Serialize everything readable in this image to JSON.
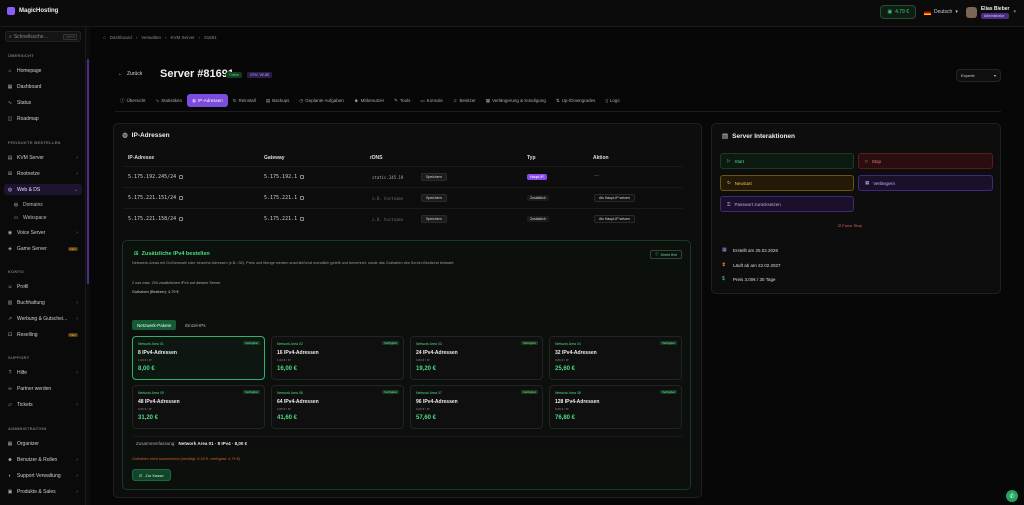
{
  "brand": {
    "name": "MagicHosting",
    "accent": "#8b5cf6",
    "success": "#4ade80"
  },
  "topbar": {
    "balance": "4,79 €",
    "language": "Deutsch",
    "user_name": "Elias Bieber",
    "user_role": "Administrator"
  },
  "sidebar": {
    "search_placeholder": "Schnellsuche...",
    "search_shortcut": "Ctrl+K",
    "sections": {
      "overview": "ÜBERSICHT",
      "products": "PRODUKTE BESTELLEN",
      "konto": "KONTO",
      "support": "SUPPORT",
      "admin": "ADMINISTRATION"
    },
    "items": [
      {
        "label": "Homepage"
      },
      {
        "label": "Dashboard"
      },
      {
        "label": "Status"
      },
      {
        "label": "Roadmap"
      },
      {
        "label": "KVM Server"
      },
      {
        "label": "Rootnetze"
      },
      {
        "label": "Web & DS"
      },
      {
        "label": "Domains"
      },
      {
        "label": "Webspace"
      },
      {
        "label": "Voice Server"
      },
      {
        "label": "Game Server",
        "badge": "NEU"
      },
      {
        "label": "Profil"
      },
      {
        "label": "Buchhaltung"
      },
      {
        "label": "Werbung & Gutschei..."
      },
      {
        "label": "Reselling",
        "badge": "NEU"
      },
      {
        "label": "Hilfe"
      },
      {
        "label": "Partner werden"
      },
      {
        "label": "Tickets"
      },
      {
        "label": "Organizer"
      },
      {
        "label": "Benutzer & Rollen"
      },
      {
        "label": "Support Verwaltung"
      },
      {
        "label": "Produkte & Sales"
      }
    ]
  },
  "breadcrumb": [
    "Dashboard",
    "Verwalten",
    "KVM Server",
    "81691"
  ],
  "header": {
    "back": "Zurück",
    "title": "Server #81691",
    "status": "Online",
    "cpu": "CPU: VE-85",
    "export": "Experte"
  },
  "tabs": [
    "Übersicht",
    "Statistiken",
    "IP-Adressen",
    "Reinstall",
    "Backups",
    "Geplante Aufgaben",
    "Mitbenutzer",
    "Tools",
    "Konsole",
    "Besitzer",
    "Verlängerung & Kündigung",
    "Up-/Downgrades",
    "Logs"
  ],
  "ip": {
    "title": "IP-Adressen",
    "headers": [
      "IP-Adresse",
      "Gateway",
      "rDNS",
      "Typ",
      "Aktion"
    ],
    "save": "Speichern",
    "rows": [
      {
        "ip": "5.175.192.245/24",
        "gw": "5.175.192.1",
        "rdns": "static.245.19",
        "type": "Haupt-IP",
        "action": "—"
      },
      {
        "ip": "5.175.221.151/24",
        "gw": "5.175.221.1",
        "rdns": "z.B. hostname",
        "type": "Zusätzlich",
        "action": "Als Haupt-IP setzen"
      },
      {
        "ip": "5.175.221.158/24",
        "gw": "5.175.221.1",
        "rdns": "z.B. hostname",
        "type": "Zusätzlich",
        "action": "Als Haupt-IP setzen"
      }
    ]
  },
  "order": {
    "title": "Zusätzliche IPv4 bestellen",
    "desc": "Netzwerk-Areas mit Größenwahl oder einzelne Adressen (z.B. /32). Preis und Menge werden anschließend monatlich geteilt und berechnet, sowie das Guthaben des Server-Besitzers belastet.",
    "limit": "2 von max. 200 zusätzlichen IPv4 auf diesem Server",
    "balance": "Guthaben (Besitzer): 4,79 €",
    "how": "Direkt Hint",
    "tabs": [
      "Netzwerk-Pakete",
      "Einzel-IPs"
    ],
    "available": "Verfügbar",
    "cards": [
      {
        "name": "Network Area 01",
        "amount": "8 IPv4-Adressen",
        "per": "1,00 € / IP",
        "total": "8,00 €"
      },
      {
        "name": "Network Area 02",
        "amount": "16 IPv4-Adressen",
        "per": "1,00 € / IP",
        "total": "16,00 €"
      },
      {
        "name": "Network Area 03",
        "amount": "24 IPv4-Adressen",
        "per": "0,80 € / IP",
        "total": "19,20 €"
      },
      {
        "name": "Network Area 04",
        "amount": "32 IPv4-Adressen",
        "per": "0,80 € / IP",
        "total": "25,60 €"
      },
      {
        "name": "Network Area 05",
        "amount": "48 IPv4-Adressen",
        "per": "0,65 € / IP",
        "total": "31,20 €"
      },
      {
        "name": "Network Area 06",
        "amount": "64 IPv4-Adressen",
        "per": "0,65 € / IP",
        "total": "41,60 €"
      },
      {
        "name": "Network Area 07",
        "amount": "96 IPv4-Adressen",
        "per": "0,60 € / IP",
        "total": "57,60 €"
      },
      {
        "name": "Network Area 08",
        "amount": "128 IPv4-Adressen",
        "per": "0,60 € / IP",
        "total": "76,80 €"
      }
    ],
    "summary_label": "Zusammenfassung:",
    "summary_value": "Network Area 01 · 8 IPv4 · 8,00 €",
    "warning": "Guthaben nicht ausreichend (benötigt: 8,00 €, verfügbar: 4,79 €)",
    "cart": "Zur Kasse"
  },
  "actions": {
    "title": "Server Interaktionen",
    "start": "Start",
    "stop": "Stop",
    "restart": "Neustart",
    "extend": "Verlängern",
    "password": "Passwort zurücksetzen",
    "force": "Force Stop",
    "created": "Erstellt am 25.02.2026",
    "expires": "Läuft ab am 22.02.2027",
    "price": "Preis 3,00€ / 30 Tage"
  }
}
